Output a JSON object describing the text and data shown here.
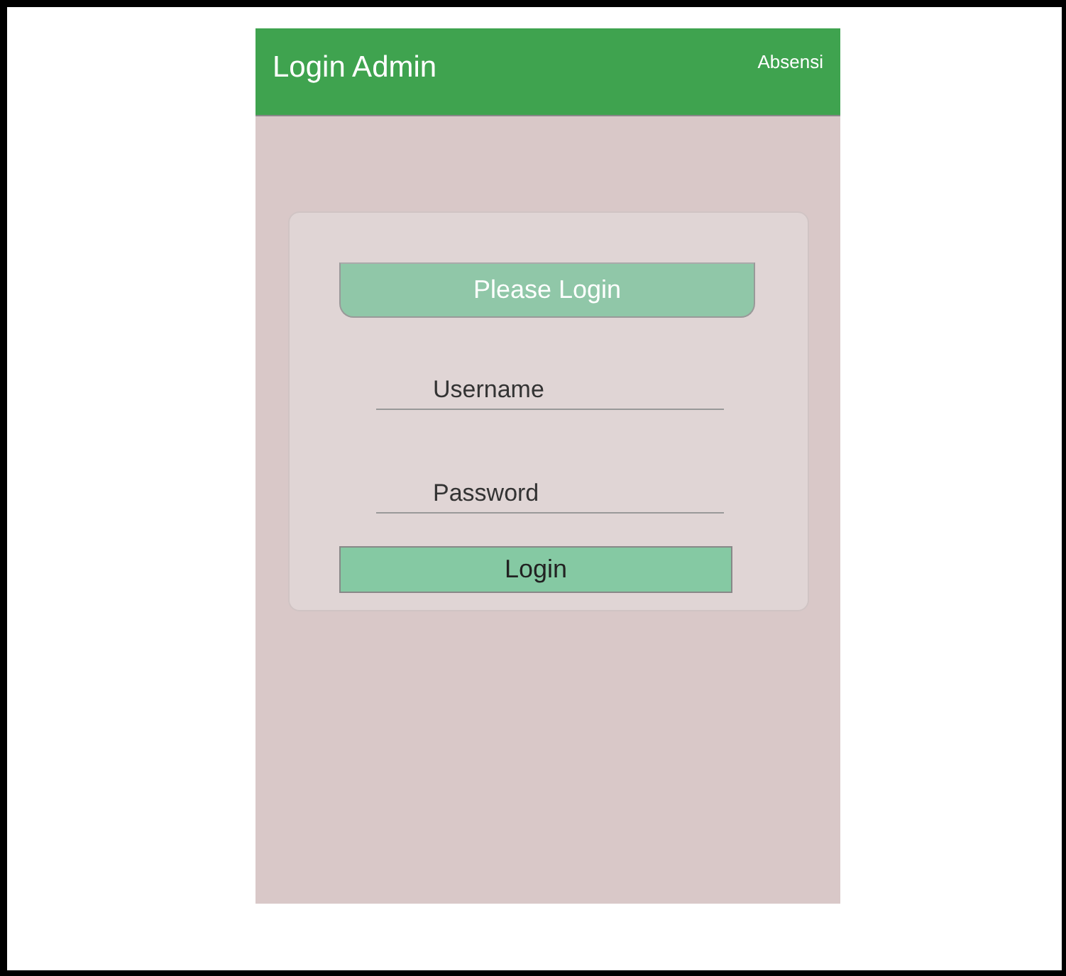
{
  "header": {
    "title": "Login Admin",
    "link": "Absensi"
  },
  "card": {
    "banner": "Please Login",
    "fields": [
      {
        "placeholder": "Username"
      },
      {
        "placeholder": "Password"
      }
    ],
    "button": "Login"
  }
}
